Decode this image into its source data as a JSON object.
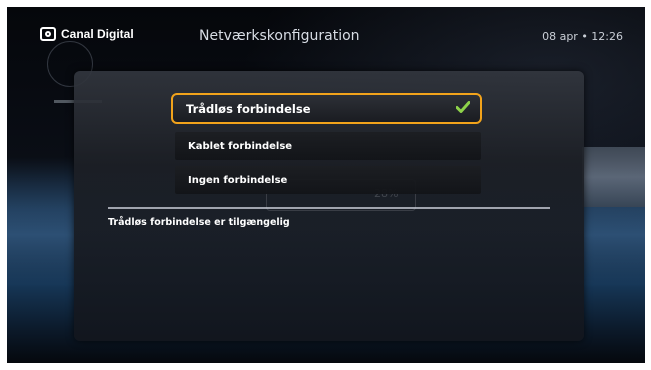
{
  "header": {
    "brand": "Canal Digital",
    "title": "Netværkskonfiguration",
    "datetime": "08 apr • 12:26"
  },
  "menu": {
    "items": [
      {
        "label": "Trådløs forbindelse",
        "selected": true,
        "checked": true
      },
      {
        "label": "Kablet forbindelse",
        "selected": false,
        "checked": false
      },
      {
        "label": "Ingen forbindelse",
        "selected": false,
        "checked": false
      }
    ]
  },
  "status": {
    "text": "Trådløs forbindelse er tilgængelig"
  },
  "background_progress": {
    "percent_label": "28%"
  },
  "colors": {
    "accent": "#f2a31b",
    "check": "#8ed24a",
    "panel": "#1c1f25"
  },
  "icons": {
    "brand": "canal-digital-logo-icon",
    "check": "checkmark-icon"
  }
}
